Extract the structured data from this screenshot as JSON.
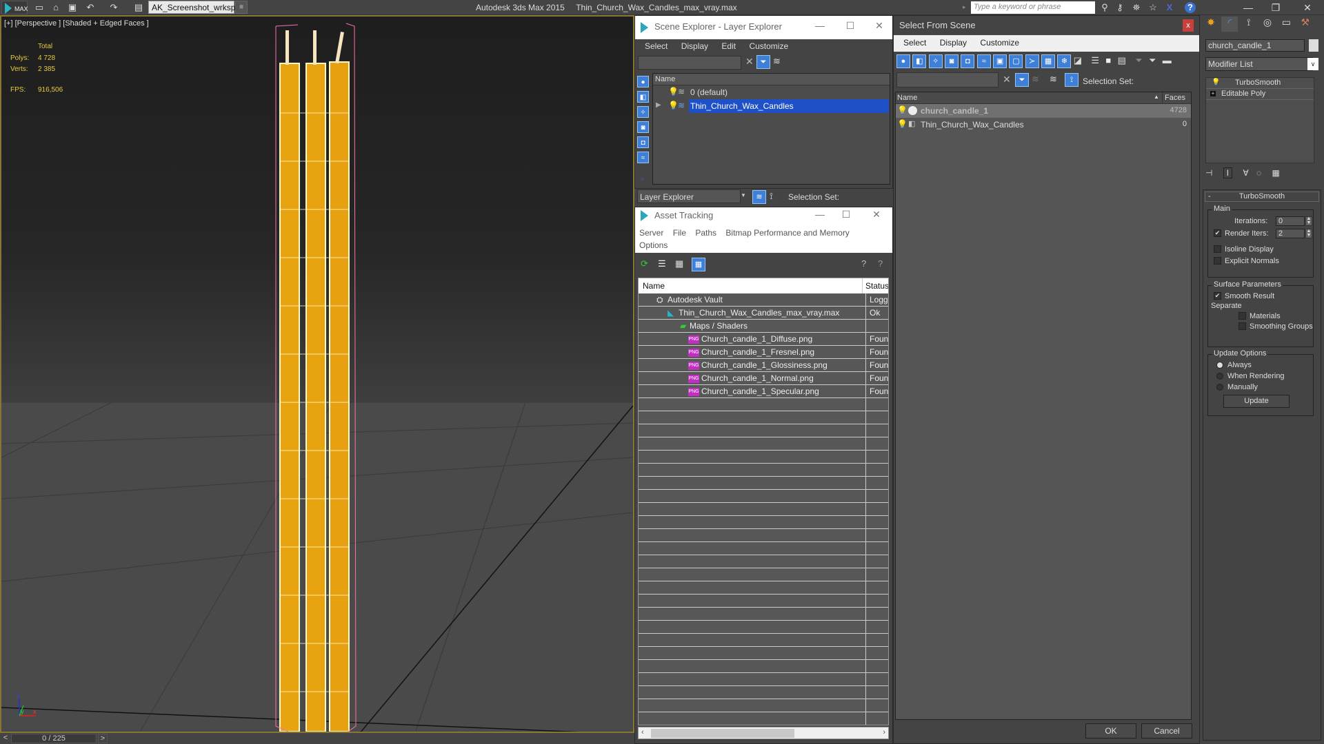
{
  "app": {
    "logo_label": "MAX",
    "title": "Autodesk 3ds Max  2015",
    "file_name": "Thin_Church_Wax_Candles_max_vray.max",
    "workspace": "AK_Screenshot_wrksp",
    "search_placeholder": "Type a keyword or phrase",
    "quick_access": [
      "new-file-icon",
      "open-file-icon",
      "save-icon",
      "undo-icon",
      "redo-icon",
      "project-folder-icon"
    ],
    "info_icons": [
      "binoculars-icon",
      "key-icon",
      "satellite-icon",
      "star-icon",
      "x-exchange-icon",
      "help-icon"
    ]
  },
  "viewport": {
    "label": "[+] [Perspective ] [Shaded + Edged Faces ]",
    "stats": {
      "header": "Total",
      "polys_label": "Polys:",
      "polys_value": "4 728",
      "verts_label": "Verts:",
      "verts_value": "2 385",
      "fps_label": "FPS:",
      "fps_value": "916,506"
    },
    "axis": {
      "z": "z",
      "y": "y",
      "x": "x"
    },
    "timeline": {
      "prev": "<",
      "value": "0 / 225",
      "next": ">"
    }
  },
  "scene_explorer": {
    "title": "Scene Explorer - Layer Explorer",
    "menu": [
      "Select",
      "Display",
      "Edit",
      "Customize"
    ],
    "column_name": "Name",
    "layers": [
      {
        "name": "0 (default)",
        "selected": false
      },
      {
        "name": "Thin_Church_Wax_Candles",
        "selected": true
      }
    ],
    "footer_mode": "Layer Explorer",
    "selection_set_label": "Selection Set:"
  },
  "asset_tracking": {
    "title": "Asset Tracking",
    "menu": [
      "Server",
      "File",
      "Paths",
      "Bitmap Performance and Memory",
      "Options"
    ],
    "columns": [
      "Name",
      "Status"
    ],
    "rows": [
      {
        "name": "Autodesk Vault",
        "status": "Logged",
        "level": 0,
        "icon": "vault-icon"
      },
      {
        "name": "Thin_Church_Wax_Candles_max_vray.max",
        "status": "Ok",
        "level": 1,
        "icon": "max-file-icon"
      },
      {
        "name": "Maps / Shaders",
        "status": "",
        "level": 2,
        "icon": "maps-icon"
      },
      {
        "name": "Church_candle_1_Diffuse.png",
        "status": "Found",
        "level": 3,
        "icon": "png-icon"
      },
      {
        "name": "Church_candle_1_Fresnel.png",
        "status": "Found",
        "level": 3,
        "icon": "png-icon"
      },
      {
        "name": "Church_candle_1_Glossiness.png",
        "status": "Found",
        "level": 3,
        "icon": "png-icon"
      },
      {
        "name": "Church_candle_1_Normal.png",
        "status": "Found",
        "level": 3,
        "icon": "png-icon"
      },
      {
        "name": "Church_candle_1_Specular.png",
        "status": "Found",
        "level": 3,
        "icon": "png-icon"
      }
    ],
    "png_badge": "PNG"
  },
  "select_from_scene": {
    "title": "Select From Scene",
    "menu": [
      "Select",
      "Display",
      "Customize"
    ],
    "selection_set_label": "Selection Set:",
    "columns": [
      "Name",
      "Faces"
    ],
    "rows": [
      {
        "name": "church_candle_1",
        "faces": "4728",
        "selected": true
      },
      {
        "name": "Thin_Church_Wax_Candles",
        "faces": "0",
        "selected": false
      }
    ],
    "ok": "OK",
    "cancel": "Cancel"
  },
  "command_panel": {
    "object_name": "church_candle_1",
    "modifier_list": "Modifier List",
    "stack": [
      "TurboSmooth",
      "Editable Poly"
    ],
    "rollout_title": "TurboSmooth",
    "rollout_toggle": "-",
    "main_group": "Main",
    "iterations_label": "Iterations:",
    "iterations_value": "0",
    "render_iters_label": "Render Iters:",
    "render_iters_value": "2",
    "render_iters_checked": true,
    "isoline_label": "Isoline Display",
    "isoline_checked": false,
    "explicit_normals_label": "Explicit Normals",
    "explicit_normals_checked": false,
    "surface_group": "Surface Parameters",
    "smooth_result_label": "Smooth Result",
    "smooth_result_checked": true,
    "separate_label": "Separate",
    "materials_label": "Materials",
    "smoothing_groups_label": "Smoothing Groups",
    "update_group": "Update Options",
    "update_options": [
      "Always",
      "When Rendering",
      "Manually"
    ],
    "update_selected": "Always",
    "update_button": "Update"
  },
  "colors": {
    "accent_blue": "#3e7fd8",
    "selection_blue": "#1e50c8",
    "stat_yellow": "#e8cc3c",
    "viewport_border": "#8a7630",
    "candle_orange": "#e8a410",
    "bbox_pink": "#ff70b0",
    "close_red": "#c8403c"
  }
}
